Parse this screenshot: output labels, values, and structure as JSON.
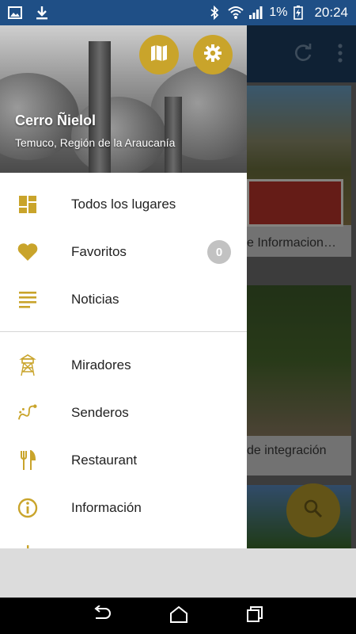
{
  "status_bar": {
    "battery": "1%",
    "time": "20:24"
  },
  "drawer": {
    "header": {
      "title": "Cerro Ñielol",
      "subtitle": "Temuco, Región de la Araucanía"
    },
    "items_group1": [
      {
        "label": "Todos los lugares",
        "icon": "dashboard-icon"
      },
      {
        "label": "Favoritos",
        "icon": "heart-icon",
        "badge": "0"
      },
      {
        "label": "Noticias",
        "icon": "notes-icon"
      }
    ],
    "items_group2": [
      {
        "label": "Miradores",
        "icon": "lookout-tower-icon"
      },
      {
        "label": "Senderos",
        "icon": "trail-icon"
      },
      {
        "label": "Restaurant",
        "icon": "fork-knife-icon"
      },
      {
        "label": "Información",
        "icon": "info-icon"
      }
    ]
  },
  "background": {
    "card1_title": "e Informacion…",
    "card2_title": "de integración"
  },
  "colors": {
    "accent": "#c9a42b",
    "status_bar": "#1f4f86",
    "toolbar": "#1c3c5f"
  }
}
